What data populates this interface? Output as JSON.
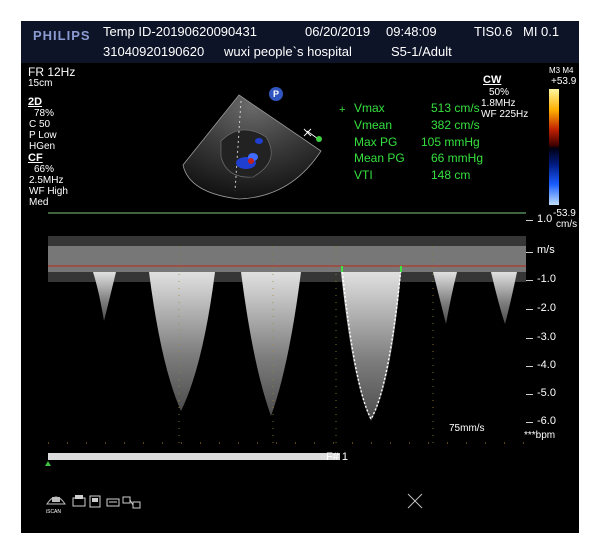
{
  "header": {
    "brand": "PHILIPS",
    "patient_id": "Temp ID-20190620090431",
    "date": "06/20/2019",
    "time": "09:48:09",
    "tis": "TIS0.6",
    "mi": "MI 0.1",
    "exam_number": "31040920190620",
    "hospital": "wuxi people`s hospital",
    "probe_preset": "S5-1/Adult"
  },
  "left_params": {
    "fr": "FR 12Hz",
    "depth": "15cm",
    "mode_2d": "2D",
    "gain_2d": "78%",
    "compress": "C 50",
    "power": "P Low",
    "res": "HGen",
    "mode_cf": "CF",
    "gain_cf": "66%",
    "freq_cf": "2.5MHz",
    "wf": "WF High",
    "med": "Med"
  },
  "right_params": {
    "cw_mode": "CW",
    "cw_gain": "50%",
    "cw_freq": "1.8MHz",
    "cw_wf": "WF 225Hz",
    "map": "M3 M4",
    "color_max": "+53.9",
    "color_min": "-53.9",
    "color_unit": "cm/s"
  },
  "measurements": [
    {
      "label": "Vmax",
      "value": "513 cm/s"
    },
    {
      "label": "Vmean",
      "value": "382 cm/s"
    },
    {
      "label": "Max PG",
      "value": "105 mmHg"
    },
    {
      "label": "Mean PG",
      "value": "66 mmHg"
    },
    {
      "label": "VTI",
      "value": "148 cm"
    }
  ],
  "scale": {
    "top": "1.0",
    "unit": "m/s",
    "ticks": [
      "-1.0",
      "-2.0",
      "-3.0",
      "-4.0",
      "-5.0",
      "-6.0"
    ]
  },
  "sweep_speed": "75mm/s",
  "bpm": "***bpm",
  "frame": "F# 1",
  "progress": 0.98,
  "icon_label": "iSCAN",
  "colors": {
    "background": "#000000",
    "header_bar": "#0e1428",
    "measurement_text": "#35e03f",
    "brand": "#8b9bd2"
  }
}
